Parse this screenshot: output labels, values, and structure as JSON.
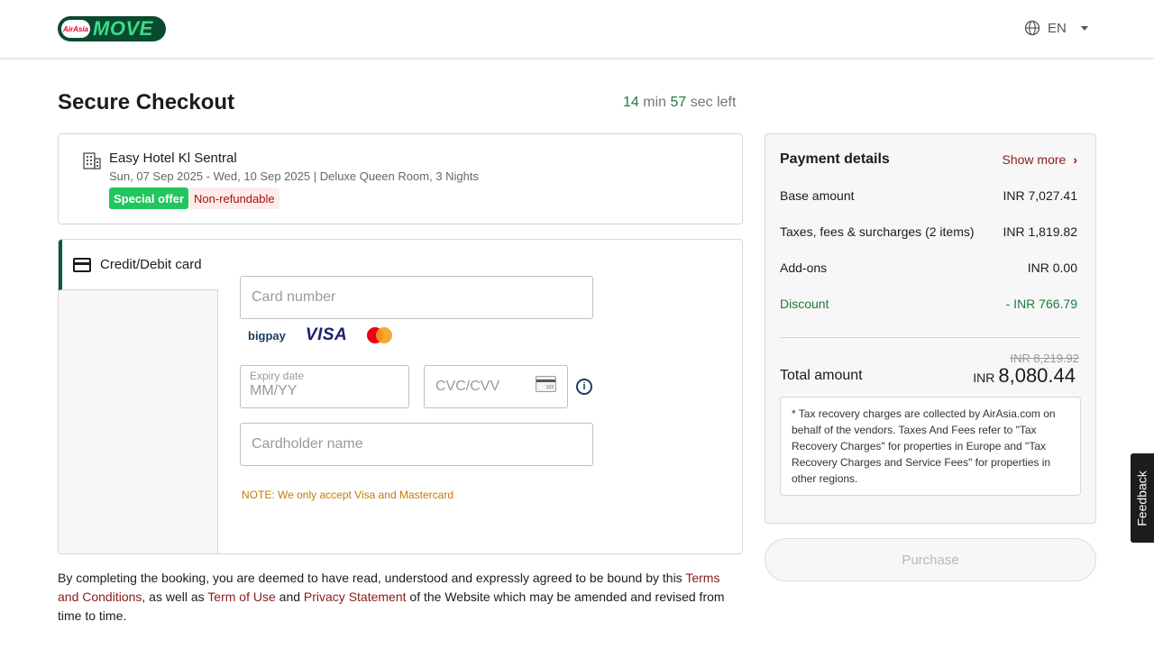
{
  "header": {
    "logo_badge": "AirAsia",
    "logo_word": "MOVE",
    "language": "EN"
  },
  "page": {
    "title": "Secure Checkout",
    "timer": {
      "minutes": "14",
      "min_label": "min",
      "seconds": "57",
      "sec_label": "sec left"
    }
  },
  "hotel": {
    "name": "Easy Hotel Kl Sentral",
    "details": "Sun, 07 Sep 2025 - Wed, 10 Sep 2025 | Deluxe Queen Room, 3 Nights",
    "badge_special": "Special offer",
    "badge_nonref": "Non-refundable"
  },
  "payment": {
    "tab_label": "Credit/Debit card",
    "card_number_placeholder": "Card number",
    "expiry_label": "Expiry date",
    "expiry_placeholder": "MM/YY",
    "cvc_placeholder": "CVC/CVV",
    "cvc_card_text": "123",
    "cardholder_placeholder": "Cardholder name",
    "brands": {
      "bigpay": "bigpay",
      "visa": "VISA"
    },
    "info_glyph": "i",
    "note": "NOTE: We only accept Visa and Mastercard"
  },
  "legal": {
    "part1": "By completing the booking, you are deemed to have read, understood and expressly agreed to be bound by this ",
    "terms": "Terms and Conditions",
    "part2": ", as well as ",
    "term_of_use": "Term of Use",
    "part3": " and ",
    "privacy": "Privacy Statement",
    "part4": " of the Website which may be amended and revised from time to time."
  },
  "summary": {
    "title": "Payment details",
    "show_more": "Show more",
    "rows": [
      {
        "label": "Base amount",
        "value": "INR 7,027.41"
      },
      {
        "label": "Taxes, fees & surcharges (2 items)",
        "value": "INR 1,819.82"
      },
      {
        "label": "Add-ons",
        "value": "INR 0.00"
      },
      {
        "label": "Discount",
        "value": "- INR 766.79"
      }
    ],
    "original_total": "INR 8,219.92",
    "total_label": "Total amount",
    "total_currency": "INR",
    "total_value": "8,080.44",
    "tax_note": "* Tax recovery charges are collected by AirAsia.com on behalf of the vendors. Taxes And Fees refer to \"Tax Recovery Charges\" for properties in Europe and \"Tax Recovery Charges and Service Fees\" for properties in other regions."
  },
  "purchase_label": "Purchase",
  "feedback_label": "Feedback",
  "colors": {
    "brand_green": "#0a4a30",
    "accent_green": "#22c55e",
    "link_red": "#8a1b1b",
    "note_orange": "#c47b00"
  }
}
